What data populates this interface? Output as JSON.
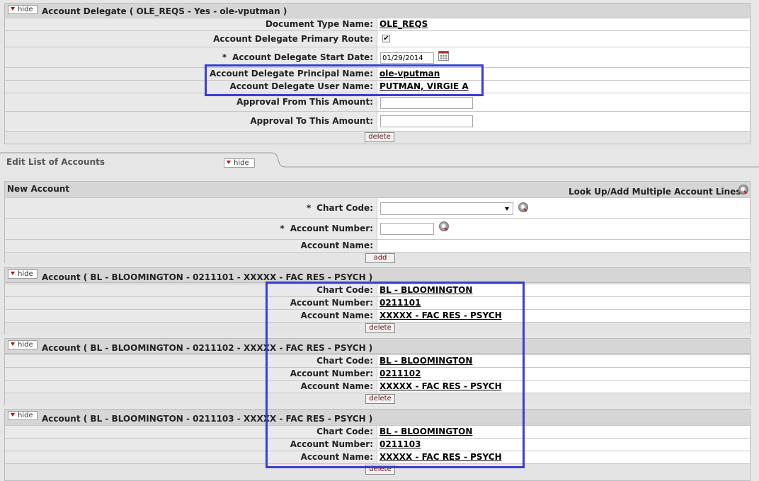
{
  "colors": {
    "highlight": "#3b3fc6",
    "link": "#000000",
    "button_text": "#6a1010"
  },
  "delegate_section": {
    "hide_label": "hide",
    "title": "Account Delegate ( OLE_REQS - Yes - ole-vputman )",
    "rows": {
      "doc_type": {
        "label": "Document Type Name:",
        "value": "OLE_REQS"
      },
      "primary_route": {
        "label": "Account Delegate Primary Route:",
        "checked": true,
        "check_glyph": "✔"
      },
      "start_date": {
        "required": "*",
        "label": "Account Delegate Start Date:",
        "value": "01/29/2014",
        "icon": "calendar-icon"
      },
      "principal": {
        "label": "Account Delegate Principal Name:",
        "value": "ole-vputman"
      },
      "user_name": {
        "label": "Account Delegate User Name:",
        "value": "PUTMAN, VIRGIE A"
      },
      "approval_from": {
        "label": "Approval From This Amount:",
        "value": ""
      },
      "approval_to": {
        "label": "Approval To This Amount:",
        "value": ""
      }
    },
    "delete_label": "delete"
  },
  "accounts_tab": {
    "title": "Edit List of Accounts",
    "hide_label": "hide"
  },
  "new_account": {
    "title": "New Account",
    "lookup_multiple": "Look Up/Add Multiple Account Lines",
    "chart_code": {
      "required": "*",
      "label": "Chart Code:",
      "selected": ""
    },
    "account_number": {
      "required": "*",
      "label": "Account Number:",
      "value": ""
    },
    "account_name": {
      "label": "Account Name:",
      "value": ""
    },
    "add_label": "add"
  },
  "accounts": [
    {
      "title": "Account ( BL - BLOOMINGTON - 0211101 - XXXXX - FAC RES - PSYCH )",
      "hide_label": "hide",
      "chart_code_label": "Chart Code:",
      "chart_code": "BL - BLOOMINGTON",
      "account_number_label": "Account Number:",
      "account_number": "0211101",
      "account_name_label": "Account Name:",
      "account_name": "XXXXX - FAC RES - PSYCH",
      "delete_label": "delete"
    },
    {
      "title": "Account ( BL - BLOOMINGTON - 0211102 - XXXXX - FAC RES - PSYCH )",
      "hide_label": "hide",
      "chart_code_label": "Chart Code:",
      "chart_code": "BL - BLOOMINGTON",
      "account_number_label": "Account Number:",
      "account_number": "0211102",
      "account_name_label": "Account Name:",
      "account_name": "XXXXX - FAC RES - PSYCH",
      "delete_label": "delete"
    },
    {
      "title": "Account ( BL - BLOOMINGTON - 0211103 - XXXXX - FAC RES - PSYCH )",
      "hide_label": "hide",
      "chart_code_label": "Chart Code:",
      "chart_code": "BL - BLOOMINGTON",
      "account_number_label": "Account Number:",
      "account_number": "0211103",
      "account_name_label": "Account Name:",
      "account_name": "XXXXX - FAC RES - PSYCH",
      "delete_label": "delete"
    }
  ]
}
